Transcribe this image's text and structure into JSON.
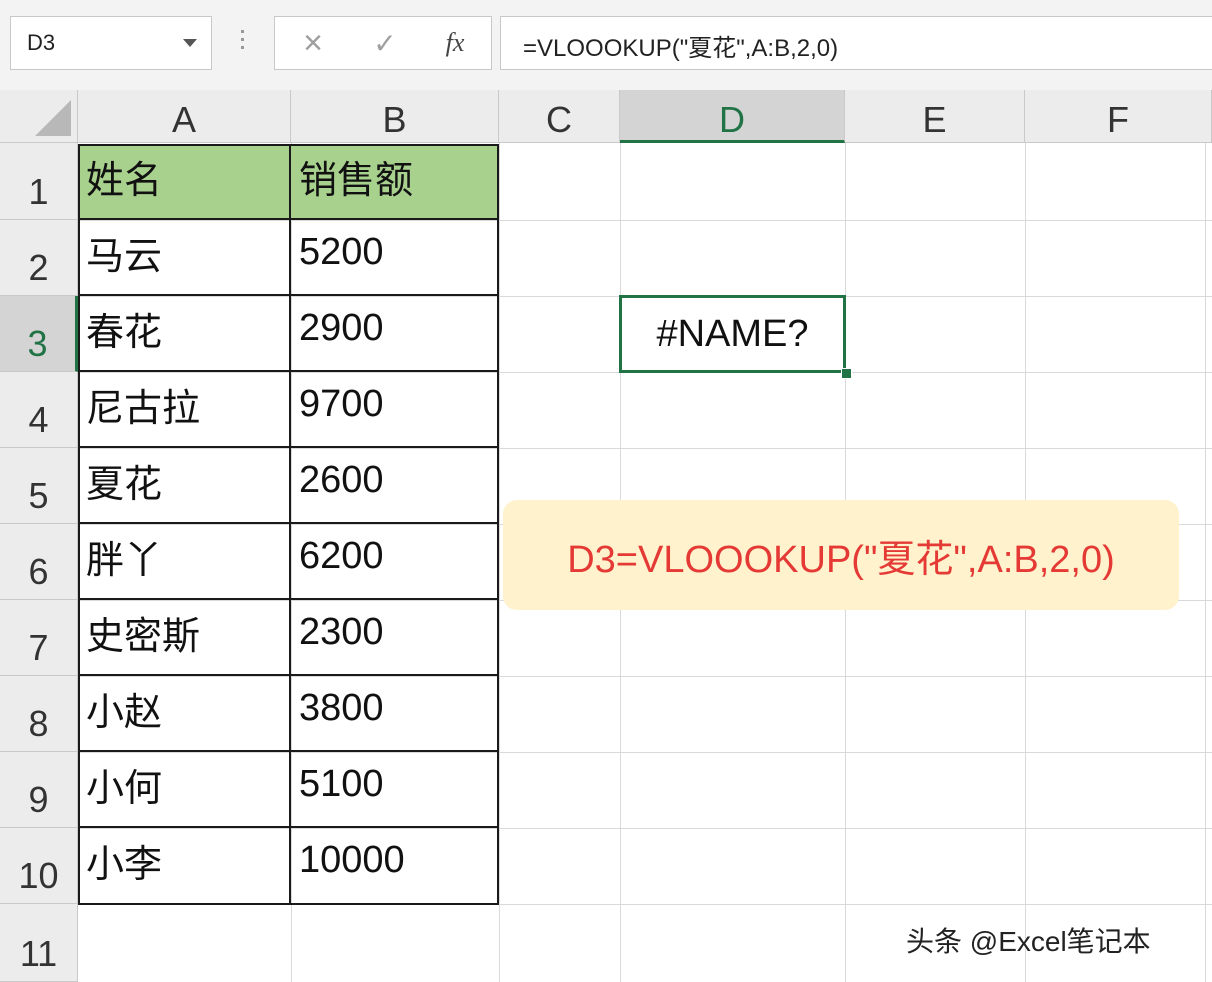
{
  "formula_toolbar": {
    "name_box": "D3",
    "cancel_icon": "×",
    "enter_icon": "✓",
    "fx_label": "fx",
    "formula": "=VLOOOKUP(\"夏花\",A:B,2,0)"
  },
  "columns": [
    "A",
    "B",
    "C",
    "D",
    "E",
    "F"
  ],
  "active_column": "D",
  "rows": [
    "1",
    "2",
    "3",
    "4",
    "5",
    "6",
    "7",
    "8",
    "9",
    "10",
    "11"
  ],
  "active_row": "3",
  "table": {
    "header": [
      "姓名",
      "销售额"
    ],
    "body": [
      [
        "马云",
        "5200"
      ],
      [
        "春花",
        "2900"
      ],
      [
        "尼古拉",
        "9700"
      ],
      [
        "夏花",
        "2600"
      ],
      [
        "胖丫",
        "6200"
      ],
      [
        "史密斯",
        "2300"
      ],
      [
        "小赵",
        "3800"
      ],
      [
        "小何",
        "5100"
      ],
      [
        "小李",
        "10000"
      ]
    ]
  },
  "active_cell_value": "#NAME?",
  "callout_text": "D3=VLOOOKUP(\"夏花\",A:B,2,0)",
  "watermark": "头条 @Excel笔记本",
  "colors": {
    "header_fill": "#a9d18e",
    "selection": "#217346",
    "callout_bg": "#fff2cc",
    "callout_text": "#e53935"
  }
}
